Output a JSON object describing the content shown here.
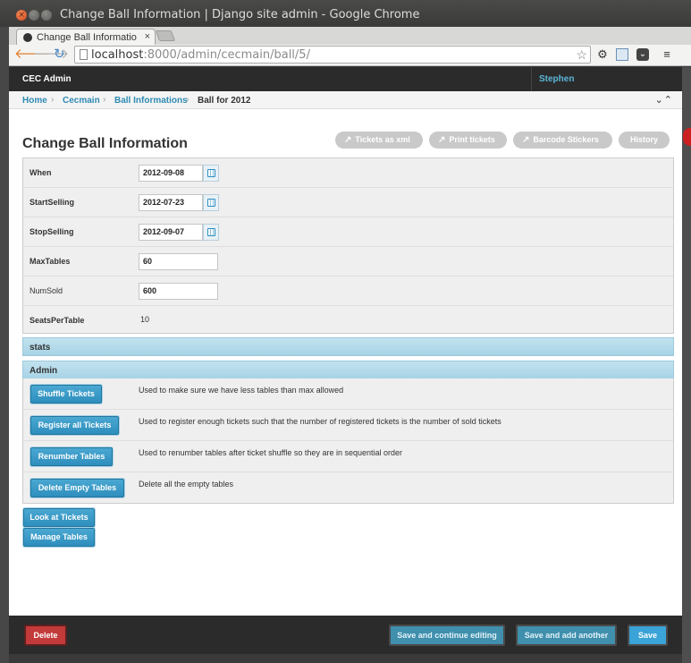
{
  "window": {
    "title": "Change Ball Information | Django site admin - Google Chrome"
  },
  "tab": {
    "title": "Change Ball Information",
    "close": "×"
  },
  "toolbar": {
    "url_host": "localhost",
    "url_rest": ":8000/admin/cecmain/ball/5/"
  },
  "admin": {
    "brand": "CEC Admin",
    "user": "Stephen"
  },
  "breadcrumbs": {
    "home": "Home",
    "app": "Cecmain",
    "model": "Ball Informations",
    "current": "Ball for 2012",
    "sep": "›",
    "collapse": "⌄⌃"
  },
  "page_title": "Change Ball Information",
  "object_tools": [
    "Tickets as xml",
    "Print tickets",
    "Barcode Stickers",
    "History"
  ],
  "fields": {
    "when": {
      "label": "When",
      "value": "2012-09-08"
    },
    "start_selling": {
      "label": "StartSelling",
      "value": "2012-07-23"
    },
    "stop_selling": {
      "label": "StopSelling",
      "value": "2012-09-07"
    },
    "max_tables": {
      "label": "MaxTables",
      "value": "60"
    },
    "num_sold": {
      "label": "NumSold",
      "value": "600"
    },
    "seats_per_table": {
      "label": "SeatsPerTable",
      "value": "10"
    }
  },
  "modules": {
    "stats": "stats",
    "admin": "Admin"
  },
  "admin_actions": [
    {
      "label": "Shuffle Tickets",
      "desc": "Used to make sure we have less tables than max allowed"
    },
    {
      "label": "Register all Tickets",
      "desc": "Used to register enough tickets such that the number of registered tickets is the number of sold tickets"
    },
    {
      "label": "Renumber Tables",
      "desc": "Used to renumber tables after ticket shuffle so they are in sequential order"
    },
    {
      "label": "Delete Empty Tables",
      "desc": "Delete all the empty tables"
    }
  ],
  "links": {
    "look_at_tickets": "Look at Tickets",
    "manage_tables": "Manage Tables"
  },
  "submit": {
    "delete": "Delete",
    "save_continue": "Save and continue editing",
    "save_add": "Save and add another",
    "save": "Save"
  },
  "colors": {
    "accent": "#2e8ebd",
    "header": "#2b2b2b",
    "delete": "#c33a3a"
  }
}
